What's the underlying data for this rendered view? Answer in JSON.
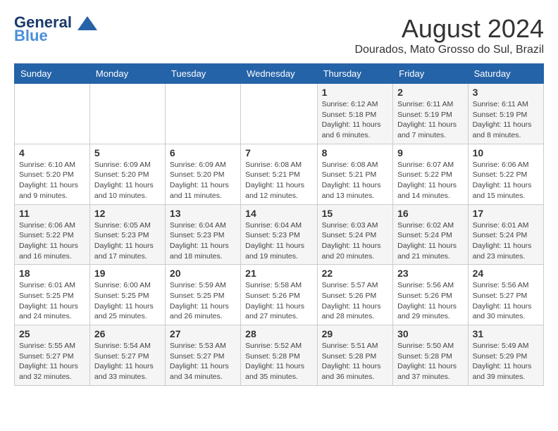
{
  "logo": {
    "line1": "General",
    "line2": "Blue"
  },
  "title": "August 2024",
  "location": "Dourados, Mato Grosso do Sul, Brazil",
  "days_of_week": [
    "Sunday",
    "Monday",
    "Tuesday",
    "Wednesday",
    "Thursday",
    "Friday",
    "Saturday"
  ],
  "weeks": [
    [
      {
        "day": "",
        "detail": ""
      },
      {
        "day": "",
        "detail": ""
      },
      {
        "day": "",
        "detail": ""
      },
      {
        "day": "",
        "detail": ""
      },
      {
        "day": "1",
        "detail": "Sunrise: 6:12 AM\nSunset: 5:18 PM\nDaylight: 11 hours\nand 6 minutes."
      },
      {
        "day": "2",
        "detail": "Sunrise: 6:11 AM\nSunset: 5:19 PM\nDaylight: 11 hours\nand 7 minutes."
      },
      {
        "day": "3",
        "detail": "Sunrise: 6:11 AM\nSunset: 5:19 PM\nDaylight: 11 hours\nand 8 minutes."
      }
    ],
    [
      {
        "day": "4",
        "detail": "Sunrise: 6:10 AM\nSunset: 5:20 PM\nDaylight: 11 hours\nand 9 minutes."
      },
      {
        "day": "5",
        "detail": "Sunrise: 6:09 AM\nSunset: 5:20 PM\nDaylight: 11 hours\nand 10 minutes."
      },
      {
        "day": "6",
        "detail": "Sunrise: 6:09 AM\nSunset: 5:20 PM\nDaylight: 11 hours\nand 11 minutes."
      },
      {
        "day": "7",
        "detail": "Sunrise: 6:08 AM\nSunset: 5:21 PM\nDaylight: 11 hours\nand 12 minutes."
      },
      {
        "day": "8",
        "detail": "Sunrise: 6:08 AM\nSunset: 5:21 PM\nDaylight: 11 hours\nand 13 minutes."
      },
      {
        "day": "9",
        "detail": "Sunrise: 6:07 AM\nSunset: 5:22 PM\nDaylight: 11 hours\nand 14 minutes."
      },
      {
        "day": "10",
        "detail": "Sunrise: 6:06 AM\nSunset: 5:22 PM\nDaylight: 11 hours\nand 15 minutes."
      }
    ],
    [
      {
        "day": "11",
        "detail": "Sunrise: 6:06 AM\nSunset: 5:22 PM\nDaylight: 11 hours\nand 16 minutes."
      },
      {
        "day": "12",
        "detail": "Sunrise: 6:05 AM\nSunset: 5:23 PM\nDaylight: 11 hours\nand 17 minutes."
      },
      {
        "day": "13",
        "detail": "Sunrise: 6:04 AM\nSunset: 5:23 PM\nDaylight: 11 hours\nand 18 minutes."
      },
      {
        "day": "14",
        "detail": "Sunrise: 6:04 AM\nSunset: 5:23 PM\nDaylight: 11 hours\nand 19 minutes."
      },
      {
        "day": "15",
        "detail": "Sunrise: 6:03 AM\nSunset: 5:24 PM\nDaylight: 11 hours\nand 20 minutes."
      },
      {
        "day": "16",
        "detail": "Sunrise: 6:02 AM\nSunset: 5:24 PM\nDaylight: 11 hours\nand 21 minutes."
      },
      {
        "day": "17",
        "detail": "Sunrise: 6:01 AM\nSunset: 5:24 PM\nDaylight: 11 hours\nand 23 minutes."
      }
    ],
    [
      {
        "day": "18",
        "detail": "Sunrise: 6:01 AM\nSunset: 5:25 PM\nDaylight: 11 hours\nand 24 minutes."
      },
      {
        "day": "19",
        "detail": "Sunrise: 6:00 AM\nSunset: 5:25 PM\nDaylight: 11 hours\nand 25 minutes."
      },
      {
        "day": "20",
        "detail": "Sunrise: 5:59 AM\nSunset: 5:25 PM\nDaylight: 11 hours\nand 26 minutes."
      },
      {
        "day": "21",
        "detail": "Sunrise: 5:58 AM\nSunset: 5:26 PM\nDaylight: 11 hours\nand 27 minutes."
      },
      {
        "day": "22",
        "detail": "Sunrise: 5:57 AM\nSunset: 5:26 PM\nDaylight: 11 hours\nand 28 minutes."
      },
      {
        "day": "23",
        "detail": "Sunrise: 5:56 AM\nSunset: 5:26 PM\nDaylight: 11 hours\nand 29 minutes."
      },
      {
        "day": "24",
        "detail": "Sunrise: 5:56 AM\nSunset: 5:27 PM\nDaylight: 11 hours\nand 30 minutes."
      }
    ],
    [
      {
        "day": "25",
        "detail": "Sunrise: 5:55 AM\nSunset: 5:27 PM\nDaylight: 11 hours\nand 32 minutes."
      },
      {
        "day": "26",
        "detail": "Sunrise: 5:54 AM\nSunset: 5:27 PM\nDaylight: 11 hours\nand 33 minutes."
      },
      {
        "day": "27",
        "detail": "Sunrise: 5:53 AM\nSunset: 5:27 PM\nDaylight: 11 hours\nand 34 minutes."
      },
      {
        "day": "28",
        "detail": "Sunrise: 5:52 AM\nSunset: 5:28 PM\nDaylight: 11 hours\nand 35 minutes."
      },
      {
        "day": "29",
        "detail": "Sunrise: 5:51 AM\nSunset: 5:28 PM\nDaylight: 11 hours\nand 36 minutes."
      },
      {
        "day": "30",
        "detail": "Sunrise: 5:50 AM\nSunset: 5:28 PM\nDaylight: 11 hours\nand 37 minutes."
      },
      {
        "day": "31",
        "detail": "Sunrise: 5:49 AM\nSunset: 5:29 PM\nDaylight: 11 hours\nand 39 minutes."
      }
    ]
  ]
}
